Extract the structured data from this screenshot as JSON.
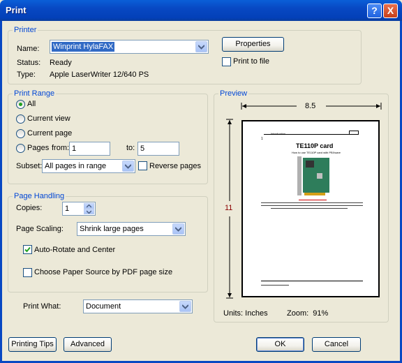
{
  "window": {
    "title": "Print",
    "help": "?",
    "close": "X"
  },
  "printer": {
    "group": "Printer",
    "name_label": "Name:",
    "name_value": "Winprint HylaFAX",
    "status_label": "Status:",
    "status_value": "Ready",
    "type_label": "Type:",
    "type_value": "Apple LaserWriter 12/640 PS",
    "properties": "Properties",
    "print_to_file": "Print to file"
  },
  "range": {
    "group": "Print Range",
    "all": "All",
    "current_view": "Current view",
    "current_page": "Current page",
    "pages": "Pages",
    "from_label": "from:",
    "from_value": "1",
    "to_label": "to:",
    "to_value": "5",
    "subset_label": "Subset:",
    "subset_value": "All pages in range",
    "reverse": "Reverse pages",
    "selected": "all"
  },
  "handling": {
    "group": "Page Handling",
    "copies_label": "Copies:",
    "copies_value": "1",
    "scaling_label": "Page Scaling:",
    "scaling_value": "Shrink large pages",
    "auto_rotate": "Auto-Rotate and Center",
    "auto_rotate_checked": true,
    "paper_source": "Choose Paper Source by PDF page size",
    "paper_source_checked": false
  },
  "print_what": {
    "label": "Print What:",
    "value": "Document"
  },
  "preview": {
    "group": "Preview",
    "width": "8.5",
    "height": "11",
    "units": "Units: Inches",
    "zoom": "Zoom:  91%",
    "page": {
      "header_num": "1",
      "header_title": "Introduction",
      "title": "TE110P card",
      "subtitle": "How to use TE110P card with PBXware"
    }
  },
  "footer": {
    "printing_tips": "Printing Tips",
    "advanced": "Advanced",
    "ok": "OK",
    "cancel": "Cancel"
  },
  "colors": {
    "accent": "#0046D5",
    "titlebar": "#0848C3"
  }
}
